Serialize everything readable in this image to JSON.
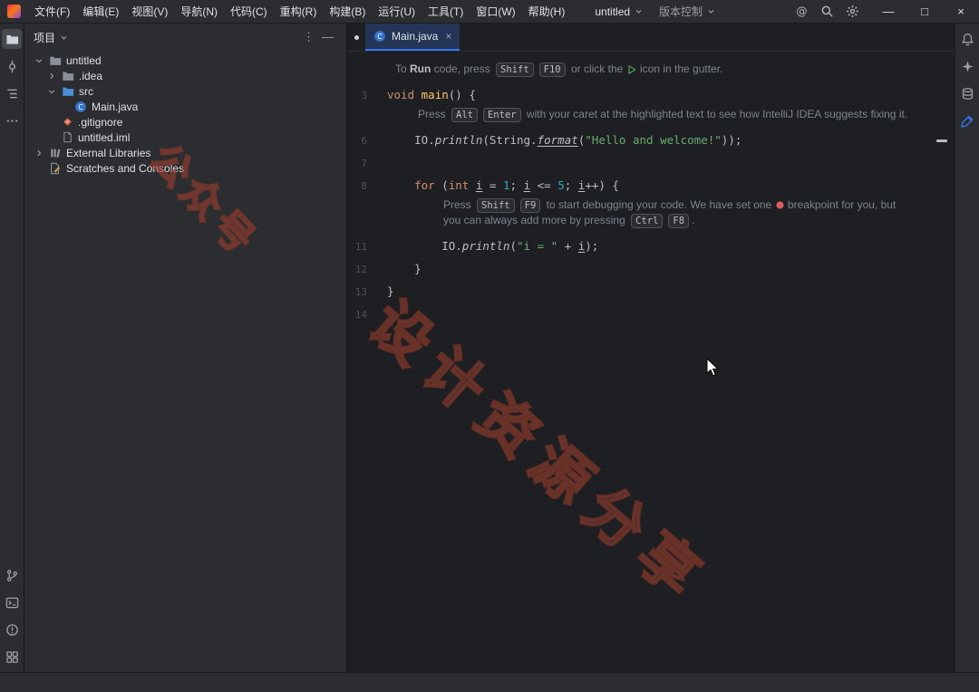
{
  "titlebar": {
    "menus": [
      "文件(F)",
      "编辑(E)",
      "视图(V)",
      "导航(N)",
      "代码(C)",
      "重构(R)",
      "构建(B)",
      "运行(U)",
      "工具(T)",
      "窗口(W)",
      "帮助(H)"
    ],
    "project_widget": "untitled",
    "vcs_widget": "版本控制",
    "tool_icons": [
      "at",
      "search",
      "settings"
    ],
    "window_controls": [
      {
        "name": "minimize",
        "glyph": "—"
      },
      {
        "name": "maximize",
        "glyph": "□"
      },
      {
        "name": "close",
        "glyph": "×"
      }
    ]
  },
  "left_rail": {
    "active": "project",
    "top": [
      "project",
      "commit",
      "structure",
      "more"
    ],
    "bottom": [
      "version-control",
      "terminal",
      "problems",
      "services"
    ]
  },
  "right_rail": [
    "notifications",
    "ai-assistant",
    "database",
    "edit-blue"
  ],
  "project_panel": {
    "title": "项目",
    "header_icons": [
      {
        "name": "options",
        "glyph": "⋮"
      },
      {
        "name": "hide",
        "glyph": "—"
      }
    ],
    "tree": [
      {
        "label": "untitled",
        "level": 0,
        "chevron": "open",
        "icon": "folder"
      },
      {
        "label": ".idea",
        "level": 1,
        "chevron": "closed",
        "icon": "folder"
      },
      {
        "label": "src",
        "level": 1,
        "chevron": "open",
        "icon": "folder-src"
      },
      {
        "label": "Main.java",
        "level": 2,
        "chevron": "none",
        "icon": "java-class"
      },
      {
        "label": ".gitignore",
        "level": 1,
        "chevron": "none",
        "icon": "git-file"
      },
      {
        "label": "untitled.iml",
        "level": 1,
        "chevron": "none",
        "icon": "file"
      },
      {
        "label": "External Libraries",
        "level": 0,
        "chevron": "closed",
        "icon": "library"
      },
      {
        "label": "Scratches and Consoles",
        "level": 0,
        "chevron": "none",
        "icon": "scratch"
      }
    ]
  },
  "editor": {
    "tab": {
      "icon": "java-class",
      "label": "Main.java",
      "close_glyph": "×",
      "modified": true
    },
    "rows": [
      {
        "type": "hint",
        "ml": 9,
        "parts": [
          {
            "t": "To "
          },
          {
            "b": "Run"
          },
          {
            "t": " code, press "
          },
          {
            "k": "Shift"
          },
          {
            "k": "F10"
          },
          {
            "t": " or click the "
          },
          {
            "ic": "run"
          },
          {
            "t": " icon in the gutter."
          }
        ]
      },
      {
        "type": "code",
        "n": "3",
        "seg": [
          {
            "t": "void ",
            "c": "kw"
          },
          {
            "t": "main",
            "c": "fn"
          },
          {
            "t": "() {"
          }
        ]
      },
      {
        "type": "hint",
        "ml": 34,
        "parts": [
          {
            "t": "Press "
          },
          {
            "k": "Alt"
          },
          {
            "k": "Enter"
          },
          {
            "t": " with your caret at the highlighted text to see how IntelliJ IDEA suggests fixing it."
          }
        ]
      },
      {
        "type": "code",
        "n": "6",
        "seg": [
          {
            "t": "    IO."
          },
          {
            "t": "println",
            "c": "mi"
          },
          {
            "t": "(String."
          },
          {
            "t": "format",
            "c": "miu"
          },
          {
            "t": "("
          },
          {
            "t": "\"Hello and welcome!\"",
            "c": "str"
          },
          {
            "t": "));"
          }
        ]
      },
      {
        "type": "code",
        "n": "7",
        "seg": []
      },
      {
        "type": "code",
        "n": "8",
        "seg": [
          {
            "t": "    "
          },
          {
            "t": "for",
            "c": "kw"
          },
          {
            "t": " ("
          },
          {
            "t": "int",
            "c": "kw"
          },
          {
            "t": " "
          },
          {
            "t": "i",
            "c": "un"
          },
          {
            "t": " = "
          },
          {
            "t": "1",
            "c": "num"
          },
          {
            "t": "; "
          },
          {
            "t": "i",
            "c": "un"
          },
          {
            "t": " <= "
          },
          {
            "t": "5",
            "c": "num"
          },
          {
            "t": "; "
          },
          {
            "t": "i",
            "c": "un"
          },
          {
            "t": "++) {"
          }
        ]
      },
      {
        "type": "hint",
        "ml": 62,
        "jn": true,
        "parts": [
          {
            "t": "Press "
          },
          {
            "k": "Shift"
          },
          {
            "k": "F9"
          },
          {
            "t": " to start debugging your code. We have set one "
          },
          {
            "ic": "bp"
          },
          {
            "t": " breakpoint for you, but"
          }
        ]
      },
      {
        "type": "hint",
        "ml": 62,
        "jp": true,
        "parts": [
          {
            "t": "you can always add more by pressing "
          },
          {
            "k": "Ctrl"
          },
          {
            "k": "F8"
          },
          {
            "t": "."
          }
        ]
      },
      {
        "type": "code",
        "n": "11",
        "seg": [
          {
            "t": "        IO."
          },
          {
            "t": "println",
            "c": "mi"
          },
          {
            "t": "("
          },
          {
            "t": "\"i = \"",
            "c": "str"
          },
          {
            "t": " + "
          },
          {
            "t": "i",
            "c": "un"
          },
          {
            "t": ");"
          }
        ]
      },
      {
        "type": "code",
        "n": "12",
        "seg": [
          {
            "t": "    }"
          }
        ]
      },
      {
        "type": "code",
        "n": "13",
        "seg": [
          {
            "t": "}"
          }
        ]
      },
      {
        "type": "code",
        "n": "14",
        "seg": []
      }
    ]
  },
  "watermark": {
    "primary": "设计资源分享",
    "secondary": "公众号"
  },
  "colors": {
    "accent": "#3574f0",
    "keyword": "#cf8e6d",
    "string": "#6aab73",
    "number": "#2aacb8",
    "hint_text": "#7c8590",
    "run_icon": "#57965c",
    "breakpoint": "#db5c5c"
  }
}
